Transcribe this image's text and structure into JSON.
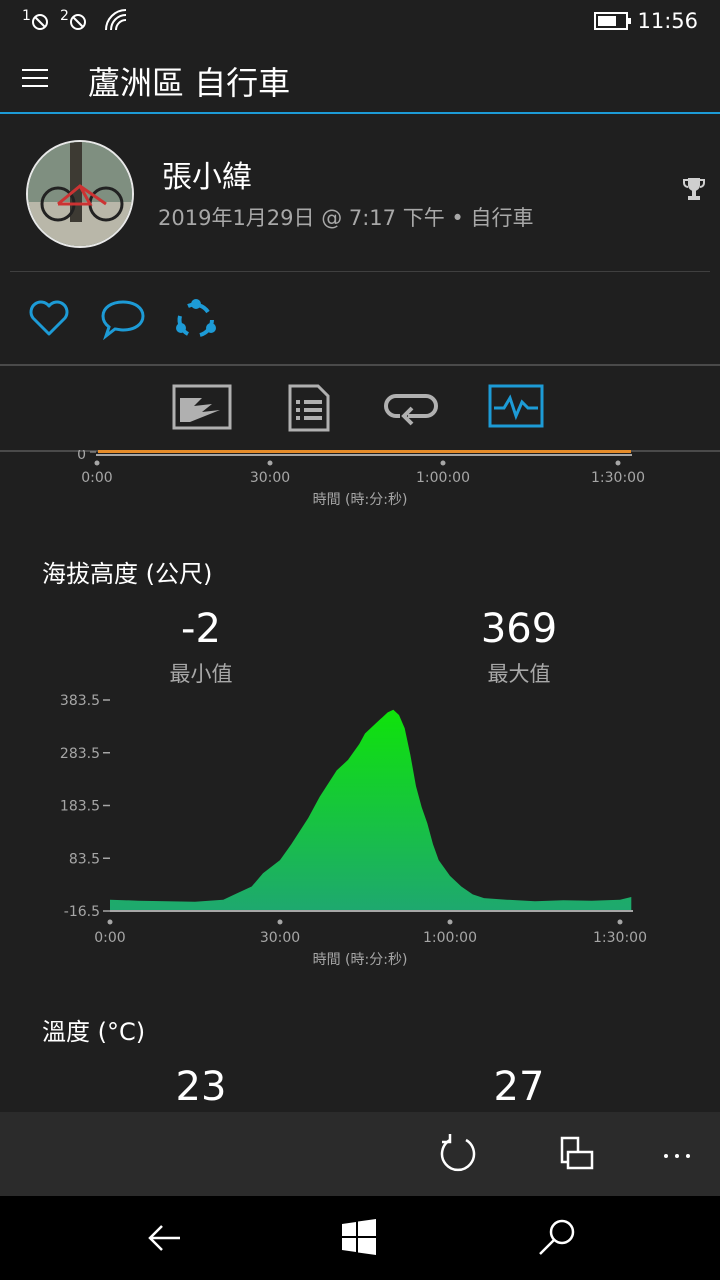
{
  "status_bar": {
    "sim1": "1",
    "sim2": "2",
    "time": "11:56"
  },
  "header": {
    "title": "蘆洲區 自行車"
  },
  "activity": {
    "user_name": "張小緯",
    "meta": "2019年1月29日 @ 7:17 下午 • 自行車"
  },
  "tabs": [
    {
      "name": "map",
      "active": false
    },
    {
      "name": "details",
      "active": false
    },
    {
      "name": "laps",
      "active": false
    },
    {
      "name": "charts",
      "active": true
    }
  ],
  "top_chart_fragment": {
    "y_tick": "0",
    "x_ticks": [
      "0:00",
      "30:00",
      "1:00:00",
      "1:30:00"
    ],
    "x_label": "時間 (時:分:秒)"
  },
  "elevation": {
    "title": "海拔高度 (公尺)",
    "min_value": "-2",
    "min_label": "最小值",
    "max_value": "369",
    "max_label": "最大值"
  },
  "chart_data": {
    "type": "area",
    "ylim": [
      -16.5,
      383.5
    ],
    "y_ticks": [
      "383.5",
      "283.5",
      "183.5",
      "83.5",
      "-16.5"
    ],
    "x_ticks": [
      "0:00",
      "30:00",
      "1:00:00",
      "1:30:00"
    ],
    "xlabel": "時間 (時:分:秒)",
    "ylabel": "",
    "x_minutes": [
      0,
      5,
      10,
      15,
      20,
      22,
      25,
      27,
      30,
      32,
      35,
      37,
      40,
      42,
      44,
      45,
      47,
      49,
      50,
      51,
      52,
      53,
      54,
      55,
      56,
      57,
      58,
      60,
      62,
      64,
      66,
      70,
      75,
      80,
      85,
      90,
      92
    ],
    "values": [
      5,
      3,
      2,
      1,
      5,
      15,
      30,
      55,
      80,
      110,
      160,
      200,
      250,
      270,
      300,
      320,
      340,
      360,
      365,
      355,
      330,
      280,
      220,
      180,
      150,
      110,
      80,
      50,
      30,
      15,
      8,
      5,
      2,
      4,
      3,
      5,
      10
    ],
    "color": "#1ec86a"
  },
  "temperature": {
    "title": "溫度 (°C)",
    "min_value": "23",
    "max_value": "27"
  },
  "colors": {
    "accent": "#1d9bd6",
    "background": "#1f1f1f",
    "series_top": "#e58c2a",
    "area_top": "#0fe30a",
    "area_bottom": "#1ea86f"
  }
}
